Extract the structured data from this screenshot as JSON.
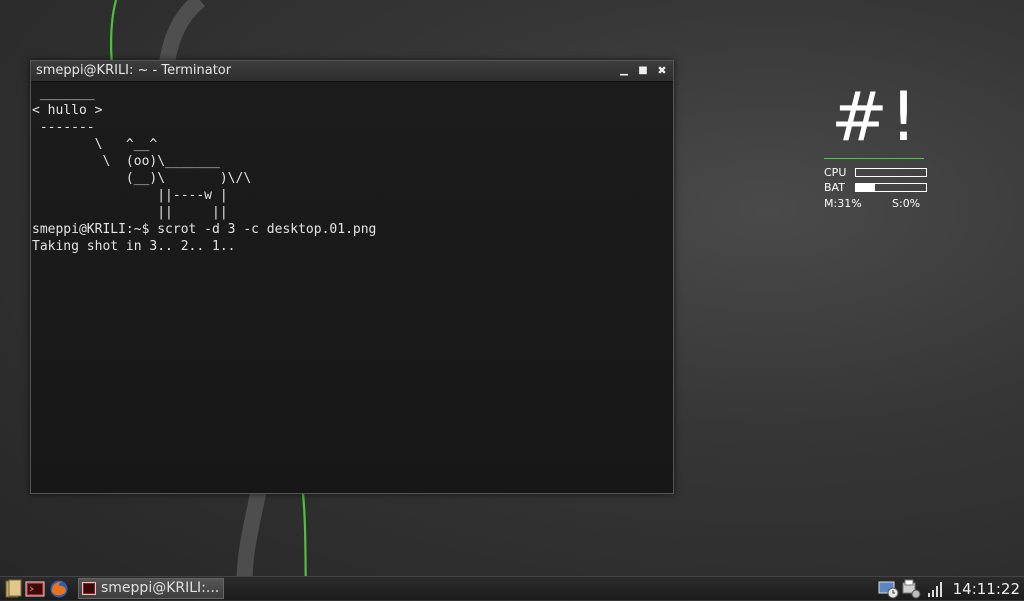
{
  "window": {
    "title": "smeppi@KRILI: ~ - Terminator",
    "minimize_glyph": "▁",
    "maximize_glyph": "■",
    "close_glyph": "✖"
  },
  "terminal": {
    "lines": [
      " _______",
      "< hullo >",
      " -------",
      "        \\   ^__^",
      "         \\  (oo)\\_______",
      "            (__)\\       )\\/\\",
      "                ||----w |",
      "                ||     ||",
      "smeppi@KRILI:~$ scrot -d 3 -c desktop.01.png",
      "Taking shot in 3.. 2.. 1.."
    ]
  },
  "conky": {
    "logo": "#!",
    "cpu_label": "CPU",
    "cpu_level": 0,
    "bat_label": "BAT",
    "bat_level": 0.27,
    "mem": "M:31%",
    "swap": "S:0%",
    "accent": "#3ed13e"
  },
  "taskbar": {
    "launchers": [
      "file-manager-icon",
      "terminal-icon",
      "firefox-icon"
    ],
    "task_label": "smeppi@KRILI:...",
    "tray_icons": [
      "network-icon",
      "printer-icon",
      "volume-icon"
    ],
    "clock": "14:11:22"
  }
}
